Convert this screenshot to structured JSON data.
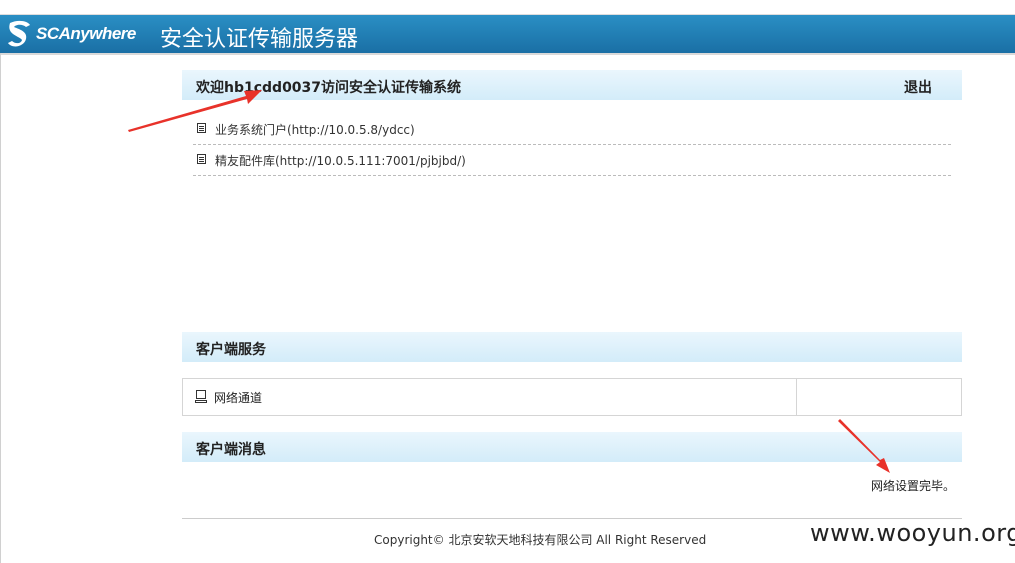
{
  "header": {
    "logo_text": "SCAnywhere",
    "title": "安全认证传输服务器"
  },
  "welcome": {
    "text": "欢迎hb1cdd0037访问安全认证传输系统",
    "logout": "退出"
  },
  "links": [
    {
      "label": "业务系统门户(http://10.0.5.8/ydcc)",
      "icon": "document-icon"
    },
    {
      "label": "精友配件库(http://10.0.5.111:7001/pjbjbd/)",
      "icon": "document-icon"
    }
  ],
  "client_services": {
    "heading": "客户端服务",
    "items": [
      {
        "label": "网络通道",
        "icon": "computer-icon"
      }
    ]
  },
  "client_messages": {
    "heading": "客户端消息",
    "message": "网络设置完毕。"
  },
  "footer": {
    "copyright": "Copyright© 北京安软天地科技有限公司 All Right Reserved"
  },
  "watermark": "www.wooyun.org",
  "colors": {
    "header": "#1a6fa5",
    "bar": "#d3ecf9",
    "arrow": "#e8322a"
  }
}
